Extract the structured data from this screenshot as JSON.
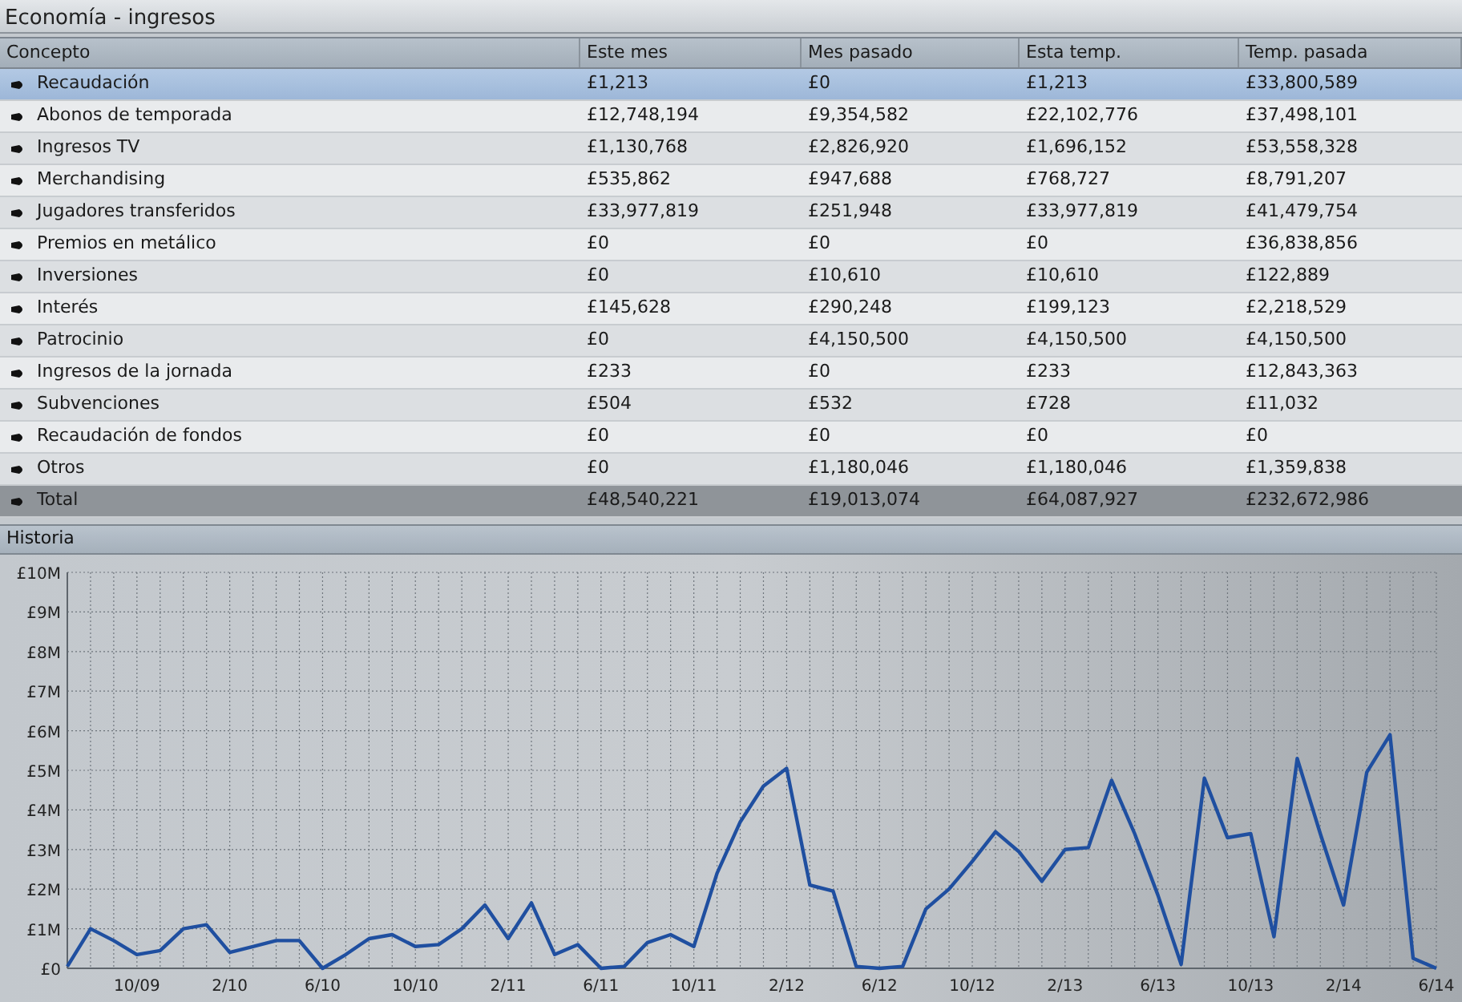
{
  "window": {
    "title": "Economía - ingresos"
  },
  "table": {
    "columns": [
      "Concepto",
      "Este mes",
      "Mes pasado",
      "Esta temp.",
      "Temp. pasada"
    ],
    "rows": [
      {
        "kind": "item",
        "selected": true,
        "cells": [
          "Recaudación",
          "£1,213",
          "£0",
          "£1,213",
          "£33,800,589"
        ]
      },
      {
        "kind": "item",
        "selected": false,
        "cells": [
          "Abonos de temporada",
          "£12,748,194",
          "£9,354,582",
          "£22,102,776",
          "£37,498,101"
        ]
      },
      {
        "kind": "item",
        "selected": false,
        "cells": [
          "Ingresos TV",
          "£1,130,768",
          "£2,826,920",
          "£1,696,152",
          "£53,558,328"
        ]
      },
      {
        "kind": "item",
        "selected": false,
        "cells": [
          "Merchandising",
          "£535,862",
          "£947,688",
          "£768,727",
          "£8,791,207"
        ]
      },
      {
        "kind": "item",
        "selected": false,
        "cells": [
          "Jugadores transferidos",
          "£33,977,819",
          "£251,948",
          "£33,977,819",
          "£41,479,754"
        ]
      },
      {
        "kind": "item",
        "selected": false,
        "cells": [
          "Premios en metálico",
          "£0",
          "£0",
          "£0",
          "£36,838,856"
        ]
      },
      {
        "kind": "item",
        "selected": false,
        "cells": [
          "Inversiones",
          "£0",
          "£10,610",
          "£10,610",
          "£122,889"
        ]
      },
      {
        "kind": "item",
        "selected": false,
        "cells": [
          "Interés",
          "£145,628",
          "£290,248",
          "£199,123",
          "£2,218,529"
        ]
      },
      {
        "kind": "item",
        "selected": false,
        "cells": [
          "Patrocinio",
          "£0",
          "£4,150,500",
          "£4,150,500",
          "£4,150,500"
        ]
      },
      {
        "kind": "item",
        "selected": false,
        "cells": [
          "Ingresos de la jornada",
          "£233",
          "£0",
          "£233",
          "£12,843,363"
        ]
      },
      {
        "kind": "item",
        "selected": false,
        "cells": [
          "Subvenciones",
          "£504",
          "£532",
          "£728",
          "£11,032"
        ]
      },
      {
        "kind": "item",
        "selected": false,
        "cells": [
          "Recaudación de fondos",
          "£0",
          "£0",
          "£0",
          "£0"
        ]
      },
      {
        "kind": "item",
        "selected": false,
        "cells": [
          "Otros",
          "£0",
          "£1,180,046",
          "£1,180,046",
          "£1,359,838"
        ]
      },
      {
        "kind": "total",
        "selected": false,
        "cells": [
          "Total",
          "£48,540,221",
          "£19,013,074",
          "£64,087,927",
          "£232,672,986"
        ]
      }
    ]
  },
  "history": {
    "title": "Historia",
    "chart_data": {
      "type": "line",
      "categories": [
        null,
        null,
        null,
        "10/09",
        null,
        null,
        null,
        "2/10",
        null,
        null,
        null,
        "6/10",
        null,
        null,
        null,
        "10/10",
        null,
        null,
        null,
        "2/11",
        null,
        null,
        null,
        "6/11",
        null,
        null,
        null,
        "10/11",
        null,
        null,
        null,
        "2/12",
        null,
        null,
        null,
        "6/12",
        null,
        null,
        null,
        "10/12",
        null,
        null,
        null,
        "2/13",
        null,
        null,
        null,
        "6/13",
        null,
        null,
        null,
        "10/13",
        null,
        null,
        null,
        "2/14",
        null,
        null,
        null,
        "6/14"
      ],
      "series": [
        {
          "color": "#1f4fa0",
          "values": [
            50000,
            1000000,
            700000,
            350000,
            450000,
            1000000,
            1100000,
            400000,
            550000,
            700000,
            700000,
            0,
            350000,
            750000,
            850000,
            550000,
            600000,
            1000000,
            1600000,
            750000,
            1650000,
            350000,
            600000,
            0,
            50000,
            650000,
            850000,
            550000,
            2400000,
            3700000,
            4600000,
            5050000,
            2100000,
            1950000,
            50000,
            0,
            50000,
            1500000,
            2000000,
            2700000,
            3450000,
            2950000,
            2200000,
            3000000,
            3050000,
            4750000,
            3400000,
            1850000,
            100000,
            4800000,
            3300000,
            3400000,
            800000,
            5300000,
            3400000,
            1600000,
            4950000,
            5900000,
            250000,
            0
          ]
        }
      ],
      "ylim": [
        0,
        10000000
      ],
      "grid": true,
      "yticks": [
        {
          "value": 0,
          "label": "£0"
        },
        {
          "value": 1000000,
          "label": "£1M"
        },
        {
          "value": 2000000,
          "label": "£2M"
        },
        {
          "value": 3000000,
          "label": "£3M"
        },
        {
          "value": 4000000,
          "label": "£4M"
        },
        {
          "value": 5000000,
          "label": "£5M"
        },
        {
          "value": 6000000,
          "label": "£6M"
        },
        {
          "value": 7000000,
          "label": "£7M"
        },
        {
          "value": 8000000,
          "label": "£8M"
        },
        {
          "value": 9000000,
          "label": "£9M"
        },
        {
          "value": 10000000,
          "label": "£10M"
        }
      ]
    }
  }
}
